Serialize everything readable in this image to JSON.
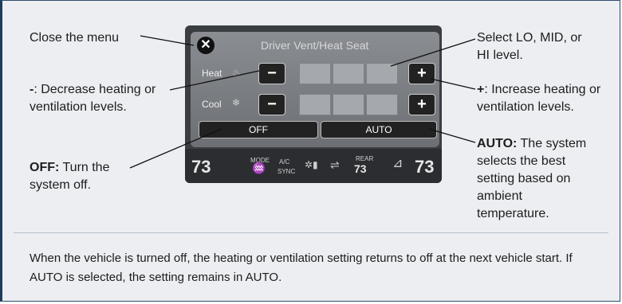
{
  "callouts": {
    "close": "Close the menu",
    "select_level": "Select LO, MID, or HI level.",
    "decrease_key": "-",
    "decrease_text": ": Decrease heating or ventilation levels.",
    "increase_key": "+",
    "increase_text": ": Increase heating or ventilation levels.",
    "off_key": "OFF:",
    "off_text": " Turn the system off.",
    "auto_key": "AUTO:",
    "auto_text": " The system selects the best setting based on ambient temperature."
  },
  "screen": {
    "title": "Driver Vent/Heat Seat",
    "heat_label": "Heat",
    "cool_label": "Cool",
    "minus": "−",
    "plus": "+",
    "off_button": "OFF",
    "auto_button": "AUTO",
    "left_temp": "73",
    "right_temp": "73",
    "mode_label": "MODE",
    "ac_label": "A/C",
    "sync_label": "SYNC",
    "rear_label": "REAR",
    "rear_temp": "73"
  },
  "footer": "When the vehicle is turned off, the heating or ventilation setting returns to off at the next vehicle start. If AUTO is selected, the setting remains in AUTO."
}
